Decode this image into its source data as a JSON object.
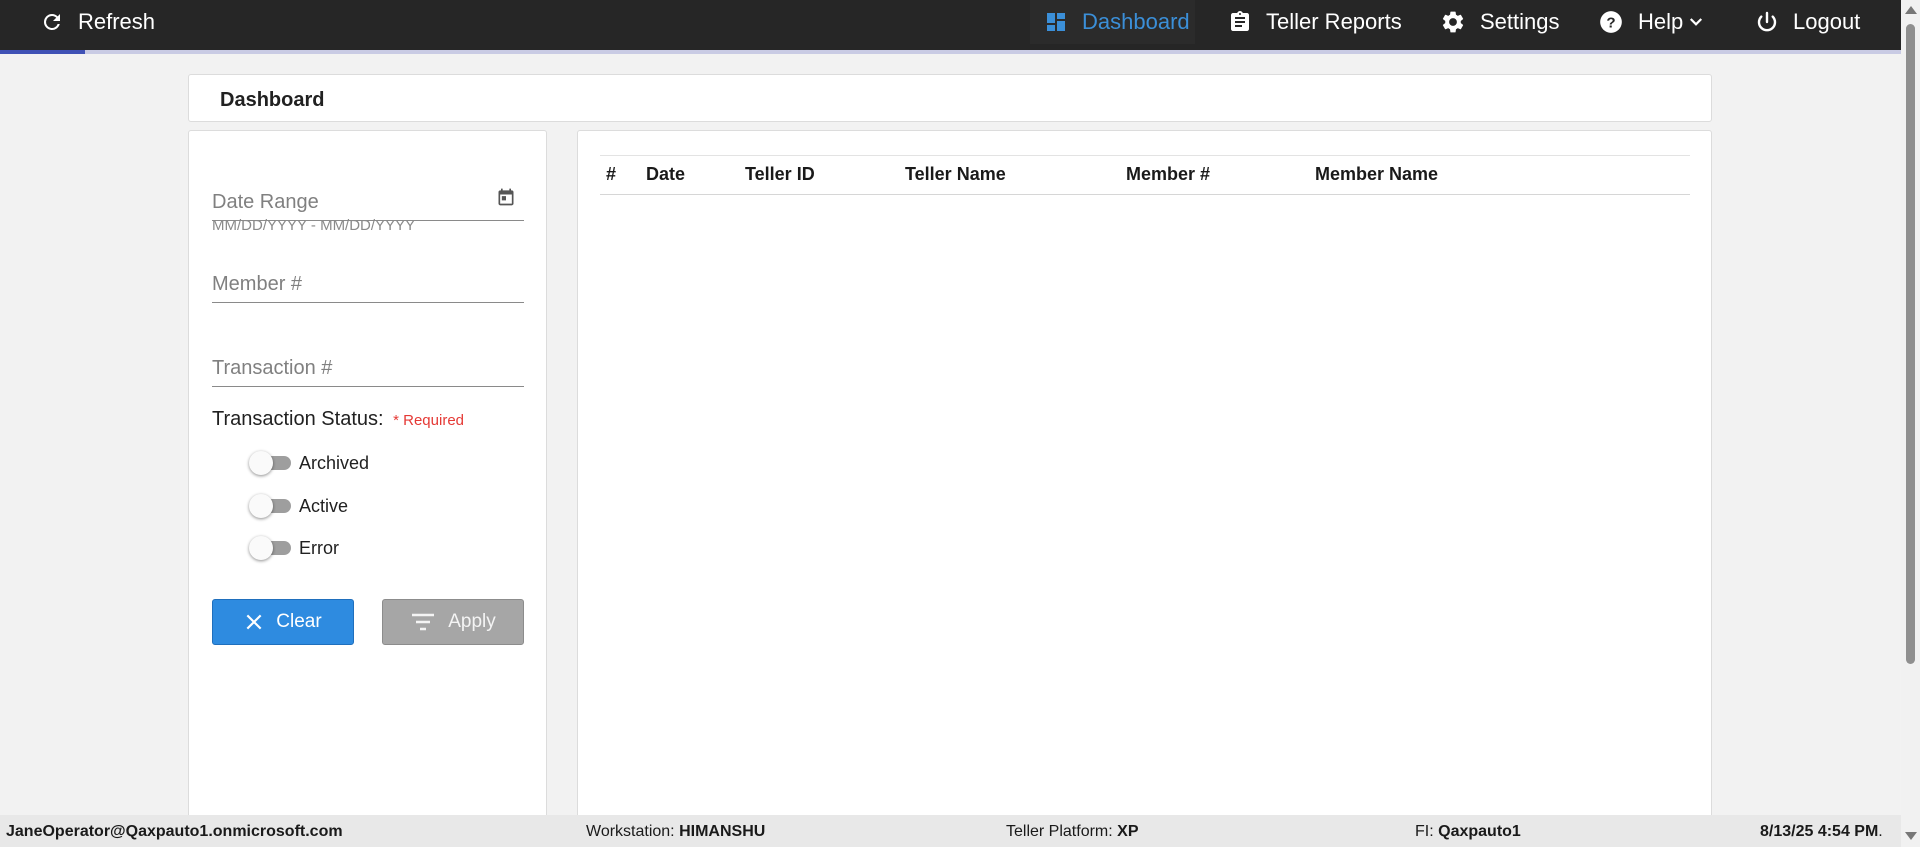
{
  "topbar": {
    "refresh_label": "Refresh",
    "nav": {
      "dashboard": "Dashboard",
      "teller_reports": "Teller Reports",
      "settings": "Settings",
      "help": "Help",
      "logout": "Logout"
    },
    "icons": {
      "refresh": "refresh-icon",
      "dashboard": "dashboard-icon",
      "teller_reports": "clipboard-icon",
      "settings": "gear-icon",
      "help": "help-icon",
      "help_caret": "chevron-down-icon",
      "logout": "power-icon"
    }
  },
  "page": {
    "title": "Dashboard"
  },
  "filters": {
    "date_range": {
      "placeholder": "Date Range",
      "hint": "MM/DD/YYYY - MM/DD/YYYY",
      "icon": "calendar-icon"
    },
    "member": {
      "placeholder": "Member #"
    },
    "transaction": {
      "placeholder": "Transaction #"
    },
    "status": {
      "label": "Transaction Status:",
      "required": "* Required",
      "options": [
        {
          "label": "Archived",
          "on": false
        },
        {
          "label": "Active",
          "on": false
        },
        {
          "label": "Error",
          "on": false
        }
      ]
    },
    "clear_label": "Clear",
    "apply_label": "Apply"
  },
  "table": {
    "columns": [
      "#",
      "Date",
      "Teller ID",
      "Teller Name",
      "Member #",
      "Member Name"
    ],
    "rows": []
  },
  "footer": {
    "user": "JaneOperator@Qaxpauto1.onmicrosoft.com",
    "workstation_label": "Workstation:",
    "workstation": "HIMANSHU",
    "platform_label": "Teller Platform:",
    "platform": "XP",
    "fi_label": "FI:",
    "fi": "Qaxpauto1",
    "datetime": "8/13/25 4:54 PM",
    "datetime_suffix": "."
  },
  "colors": {
    "topbar_bg": "#262626",
    "active_nav": "#3b8fd8",
    "progress": "#3f51b5",
    "clear_btn": "#2e8be0",
    "apply_btn_disabled": "#a6a6a6",
    "required": "#e53935"
  }
}
